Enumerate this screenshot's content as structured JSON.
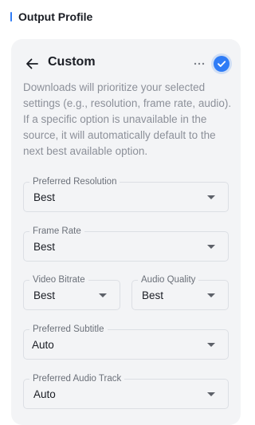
{
  "section": {
    "title": "Output Profile"
  },
  "card": {
    "title": "Custom",
    "description": "Downloads will prioritize your selected settings (e.g., resolution, frame rate, audio). If a specific option is unavailable in the source, it will automatically default to the next best available option.",
    "back_icon": "arrow-left-icon",
    "more_icon": "more-horizontal-icon",
    "selected_icon": "check-circle-icon",
    "accent_color": "#2f7cf6"
  },
  "fields": {
    "resolution": {
      "label": "Preferred Resolution",
      "value": "Best"
    },
    "frame_rate": {
      "label": "Frame Rate",
      "value": "Best"
    },
    "video_bitrate": {
      "label": "Video Bitrate",
      "value": "Best"
    },
    "audio_quality": {
      "label": "Audio Quality",
      "value": "Best"
    },
    "subtitle": {
      "label": "Preferred Subtitle",
      "value": "Auto"
    },
    "audio_track": {
      "label": "Preferred Audio Track",
      "value": "Auto"
    }
  }
}
